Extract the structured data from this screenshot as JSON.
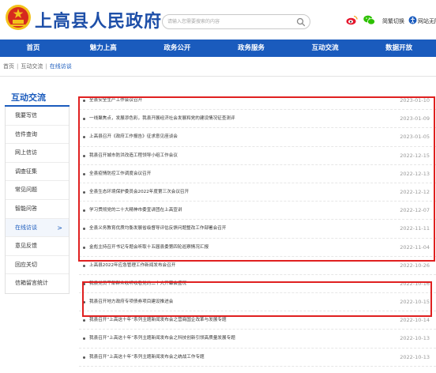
{
  "header": {
    "title": "上高县人民政府",
    "search_placeholder": "请输入您需要搜索的内容",
    "access_label": "简繁切换",
    "barrier_label": "网站无障",
    "emblem_color": "#d62a1e",
    "emblem_gold": "#f3c21b"
  },
  "nav": {
    "items": [
      "首页",
      "魅力上高",
      "政务公开",
      "政务服务",
      "互动交流",
      "数据开放"
    ],
    "bg": "#1a5bbd"
  },
  "breadcrumb": [
    "首页",
    "互动交流",
    "在线访谈"
  ],
  "sidebar": {
    "title": "互动交流",
    "items": [
      {
        "label": "我要写信",
        "active": false
      },
      {
        "label": "信件查询",
        "active": false
      },
      {
        "label": "网上信访",
        "active": false
      },
      {
        "label": "调查征集",
        "active": false
      },
      {
        "label": "常见问题",
        "active": false
      },
      {
        "label": "智能问答",
        "active": false
      },
      {
        "label": "在线访谈",
        "active": true
      },
      {
        "label": "意见反馈",
        "active": false
      },
      {
        "label": "回应关切",
        "active": false
      },
      {
        "label": "信箱留言统计",
        "active": false
      }
    ],
    "active_arrow": ">"
  },
  "articles": [
    {
      "title": "全县安全生产工作会议召开",
      "date": "2023-01-10"
    },
    {
      "title": "一线聚焦点，发展添色彩，我县开展经济社会发展和党的建设情况征查测评",
      "date": "2023-01-09"
    },
    {
      "title": "上高县召开《政府工作报告》征求意见座谈会",
      "date": "2023-01-05"
    },
    {
      "title": "我县召开城市防洪改造工程领导小组工作会议",
      "date": "2022-12-15"
    },
    {
      "title": "全县疫情防控工作调度会议召开",
      "date": "2022-12-13"
    },
    {
      "title": "全县生态环境保护委员会2022年度第三次会议召开",
      "date": "2022-12-12"
    },
    {
      "title": "学习贯彻党的二十大精神市委宣讲团在上高宣讲",
      "date": "2022-12-07"
    },
    {
      "title": "全县义务教育优质均衡发展省级督导评估反馈问题整改工作部署会召开",
      "date": "2022-11-11"
    },
    {
      "title": "金彪主持召开书记专题会听取十五届县委第四轮巡察情况汇报",
      "date": "2022-11-04"
    },
    {
      "title": "上高县2022年应急管理工作新闻发布会召开",
      "date": "2022-10-26"
    },
    {
      "title": "我县党员干部群众收听收看党的二十大开幕会盛况",
      "date": "2022-10-16"
    },
    {
      "title": "我县召开地方政府专项债券项目建设推进会",
      "date": "2022-10-15"
    },
    {
      "title": "我县召开“上高这十年”系列主题新闻发布会之营商国企改革与发展专题",
      "date": "2022-10-14"
    },
    {
      "title": "我县召开“上高这十年”系列主题新闻发布会之科技创新引领高质量发展专题",
      "date": "2022-10-13"
    },
    {
      "title": "我县召开“上高这十年”系列主题新闻发布会之统战工作专题",
      "date": "2022-10-13"
    }
  ]
}
